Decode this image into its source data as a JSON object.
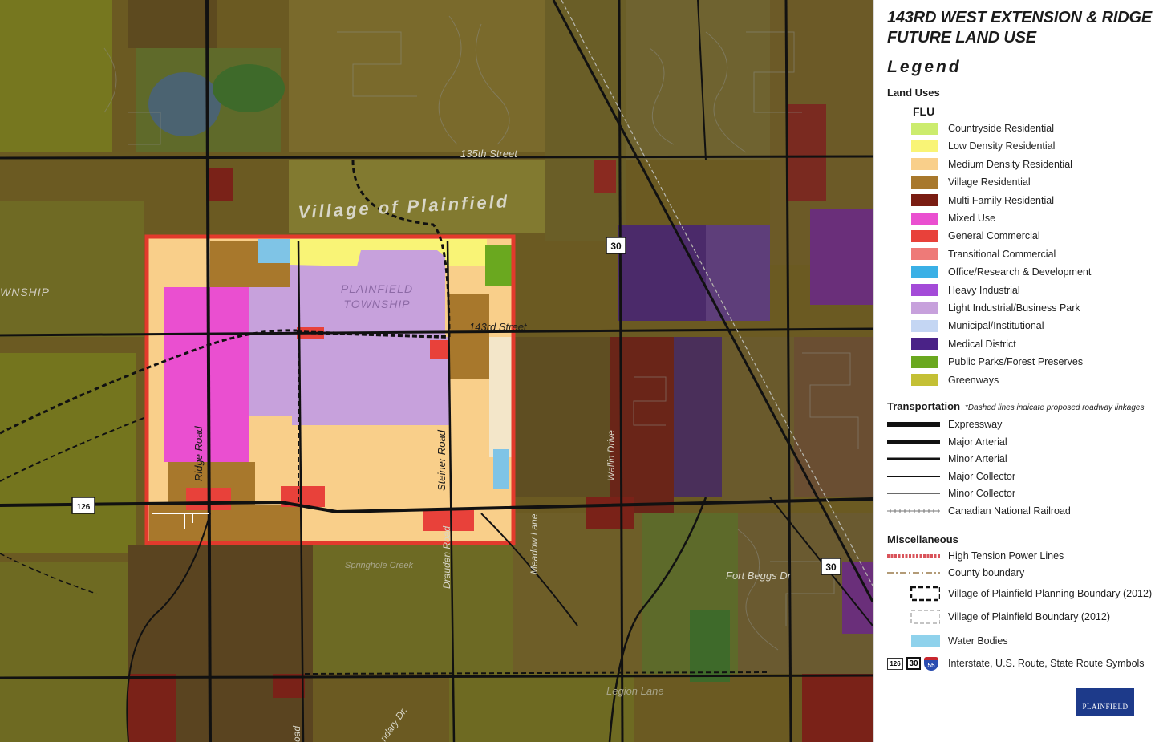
{
  "title_line1": "143RD WEST EXTENSION & RIDGE",
  "title_line2": "FUTURE LAND USE",
  "legend_heading": "Legend",
  "land_uses_heading": "Land Uses",
  "flu_heading": "FLU",
  "land_uses": [
    {
      "label": "Countryside Residential",
      "color": "#ccec6e"
    },
    {
      "label": "Low Density Residential",
      "color": "#f9f476"
    },
    {
      "label": "Medium Density Residential",
      "color": "#f9cf8a"
    },
    {
      "label": "Village Residential",
      "color": "#a8782c"
    },
    {
      "label": "Multi Family Residential",
      "color": "#7a1d12"
    },
    {
      "label": "Mixed Use",
      "color": "#ea4fd0"
    },
    {
      "label": "General Commercial",
      "color": "#e8413a"
    },
    {
      "label": "Transitional Commercial",
      "color": "#ee7a78"
    },
    {
      "label": "Office/Research & Development",
      "color": "#3ab0e6"
    },
    {
      "label": "Heavy Industrial",
      "color": "#a44bd8"
    },
    {
      "label": "Light Industrial/Business Park",
      "color": "#c7a1dc"
    },
    {
      "label": "Municipal/Institutional",
      "color": "#c4d6f3"
    },
    {
      "label": "Medical District",
      "color": "#4a2287"
    },
    {
      "label": "Public Parks/Forest Preserves",
      "color": "#6aa81f"
    },
    {
      "label": "Greenways",
      "color": "#c4c035"
    }
  ],
  "transportation_heading": "Transportation",
  "transportation_note": "*Dashed lines indicate proposed roadway linkages",
  "transportation": [
    {
      "label": "Expressway",
      "symbol": "expressway"
    },
    {
      "label": "Major Arterial",
      "symbol": "major-arterial"
    },
    {
      "label": "Minor Arterial",
      "symbol": "minor-arterial"
    },
    {
      "label": "Major Collector",
      "symbol": "major-collector"
    },
    {
      "label": "Minor Collector",
      "symbol": "minor-collector"
    },
    {
      "label": "Canadian National Railroad",
      "symbol": "railroad"
    }
  ],
  "misc_heading": "Miscellaneous",
  "misc": [
    {
      "label": "High Tension Power Lines",
      "symbol": "power-lines"
    },
    {
      "label": "County boundary",
      "symbol": "county-boundary"
    },
    {
      "label": "Village of Plainfield Planning Boundary (2012)",
      "symbol": "planning-boundary"
    },
    {
      "label": "Village of Plainfield Boundary (2012)",
      "symbol": "village-boundary"
    },
    {
      "label": "Water Bodies",
      "symbol": "water"
    },
    {
      "label": "Interstate, U.S. Route, State Route Symbols",
      "symbol": "route-shields"
    }
  ],
  "route_shields": {
    "state": "126",
    "us": "30",
    "interstate": "55"
  },
  "logo_text": "PLAINFIELD",
  "map": {
    "village_label": "Village of Plainfield",
    "township_label": "PLAINFIELD\nTOWNSHIP",
    "township_line1": "PLAINFIELD",
    "township_line2": "TOWNSHIP",
    "left_township": "WNSHIP",
    "roads": {
      "street_135": "135th Street",
      "street_143": "143rd Street",
      "ridge_road": "Ridge Road",
      "steiner_road": "Steiner Road",
      "drauden_road": "Drauden Road",
      "meadow_lane": "Meadow Lane",
      "wallin_drive": "Wallin Drive",
      "fort_beggs": "Fort Beggs Dr",
      "legion_lane": "Legion Lane",
      "springhole_creek": "Springhole Creek",
      "bottom_road": "oad",
      "bottom_dr": "ndary Dr."
    },
    "shields": {
      "route_126": "126",
      "route_30_a": "30",
      "route_30_b": "30"
    },
    "colors": {
      "base_dark": "#6b5a22",
      "highlight_border": "#e23a2c",
      "road": "#111111"
    }
  }
}
